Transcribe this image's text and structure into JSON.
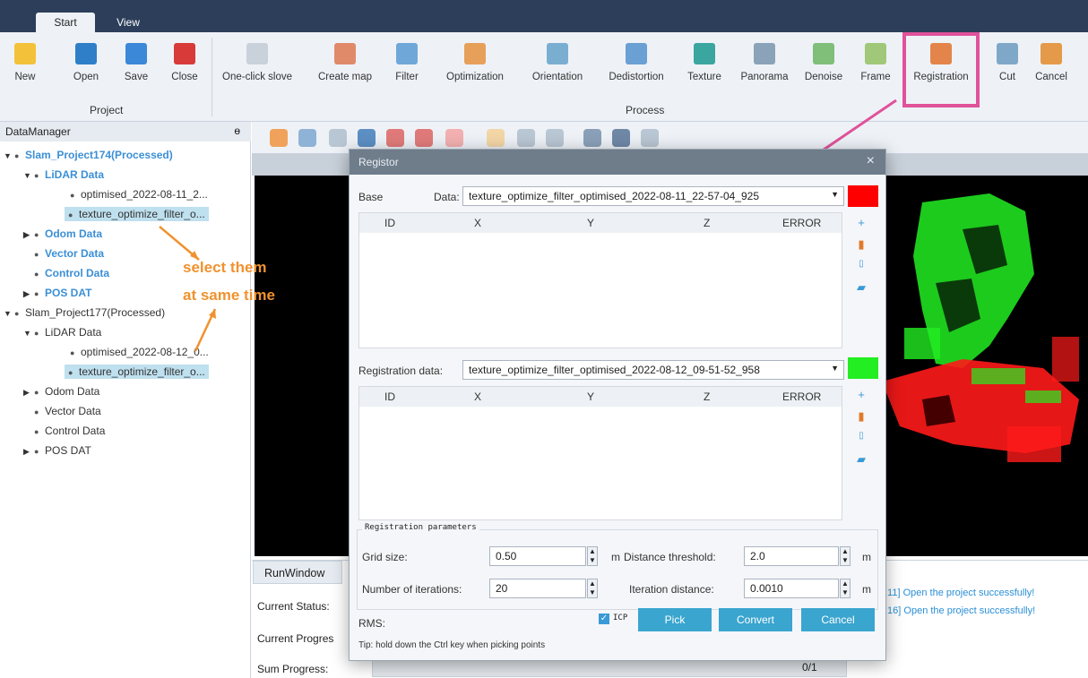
{
  "tabs": [
    "Start",
    "View"
  ],
  "ribbon": {
    "project": {
      "label": "Project",
      "buttons": [
        "New",
        "Open",
        "Save",
        "Close"
      ]
    },
    "process": {
      "label": "Process",
      "buttons": [
        "One-click slove",
        "Create map",
        "Filter",
        "Optimization",
        "Orientation",
        "Dedistortion",
        "Texture",
        "Panorama",
        "Denoise",
        "Frame",
        "Registration",
        "Cut",
        "Cancel"
      ]
    }
  },
  "datamanager": {
    "title": "DataManager",
    "pin": "ɵ",
    "tree": [
      "Slam_Project174(Processed)",
      "LiDAR Data",
      "optimised_2022-08-11_2...",
      "texture_optimize_filter_o...",
      "Odom Data",
      "Vector Data",
      "Control Data",
      "POS DAT",
      "Slam_Project177(Processed)",
      "LiDAR Data",
      "optimised_2022-08-12_0...",
      "texture_optimize_filter_o...",
      "Odom Data",
      "Vector Data",
      "Control Data",
      "POS DAT"
    ]
  },
  "annotation": {
    "line1": "select them",
    "line2": "at same time",
    "highlight": "#e0529a",
    "arrow": "#f0922f"
  },
  "dialog": {
    "title": "Registor",
    "close": "×",
    "base": {
      "group": "Base",
      "label": "Data:",
      "value": "texture_optimize_filter_optimised_2022-08-11_22-57-04_925",
      "color": "#ff0000"
    },
    "registration": {
      "label": "Registration data:",
      "value": "texture_optimize_filter_optimised_2022-08-12_09-51-52_958",
      "color": "#22ee22"
    },
    "columns": [
      "ID",
      "X",
      "Y",
      "Z",
      "ERROR"
    ],
    "params": {
      "legend": "Registration parameters",
      "grid_size_label": "Grid size:",
      "grid_size": "0.50",
      "grid_unit": "m",
      "dist_thresh_label": "Distance threshold:",
      "dist_thresh": "2.0",
      "dist_unit": "m",
      "iter_label": "Number of iterations:",
      "iter": "20",
      "iter_dist_label": "Iteration distance:",
      "iter_dist": "0.0010",
      "iter_dist_unit": "m"
    },
    "rms_label": "RMS:",
    "icp_label": "ICP",
    "buttons": {
      "pick": "Pick",
      "convert": "Convert",
      "cancel": "Cancel"
    },
    "tip": "Tip: hold down the Ctrl key when picking points"
  },
  "runwindow": {
    "tab": "RunWindow",
    "status_label": "Current Status:",
    "progress_label": "Current Progres",
    "sum_label": "Sum Progress:",
    "sum_value": "0/1",
    "log": [
      ":11] Open the project successfully!",
      ":16] Open the project successfully!"
    ]
  }
}
